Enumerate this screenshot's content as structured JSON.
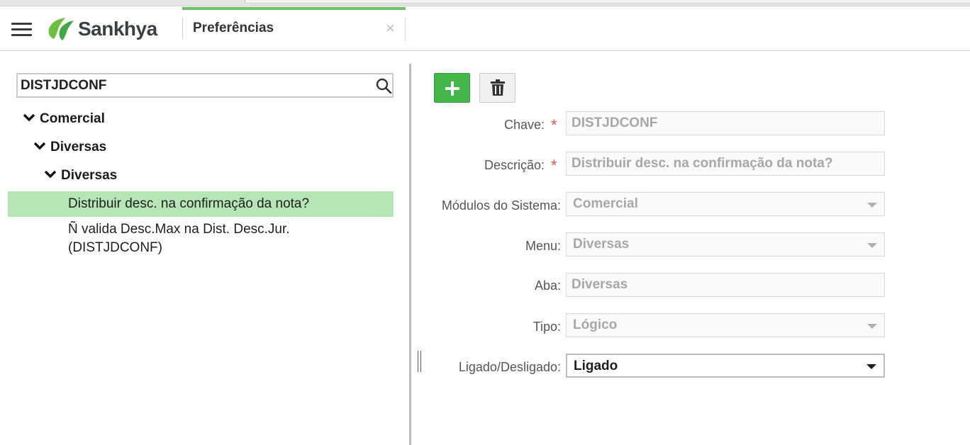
{
  "header": {
    "brand": "Sankhya",
    "tab_label": "Preferências",
    "close_glyph": "×"
  },
  "search": {
    "value": "DISTJDCONF"
  },
  "tree": {
    "level1": "Comercial",
    "level2": "Diversas",
    "level3": "Diversas",
    "leaves": [
      {
        "label": "Distribuir desc. na confirmação da nota?",
        "selected": true
      },
      {
        "label": "Ñ valida Desc.Max na Dist. Desc.Jur. (DISTJDCONF)",
        "selected": false
      }
    ]
  },
  "form": {
    "chave": {
      "label": "Chave:",
      "value": "DISTJDCONF",
      "required": true
    },
    "descricao": {
      "label": "Descrição:",
      "value": "Distribuir desc. na confirmação da nota?",
      "required": true
    },
    "modulos": {
      "label": "Módulos do Sistema:",
      "value": "Comercial"
    },
    "menu": {
      "label": "Menu:",
      "value": "Diversas"
    },
    "aba": {
      "label": "Aba:",
      "value": "Diversas"
    },
    "tipo": {
      "label": "Tipo:",
      "value": "Lógico"
    },
    "ligado": {
      "label": "Ligado/Desligado:",
      "value": "Ligado"
    },
    "required_mark": "*"
  },
  "colors": {
    "accent_green": "#42b649",
    "tab_accent": "#6cc36c",
    "selected_row": "#b6e6b6",
    "required": "#d9534f"
  },
  "icons": {
    "menu": "hamburger-icon",
    "search": "search-icon",
    "add": "plus-icon",
    "delete": "trash-icon",
    "expand": "chevron-down-icon",
    "dropdown": "caret-down-icon"
  }
}
